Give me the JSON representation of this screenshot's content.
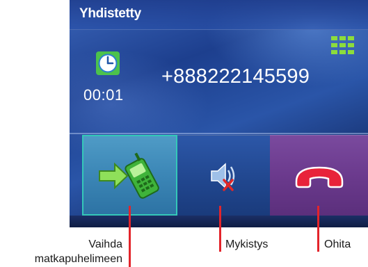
{
  "screen": {
    "title": "Yhdistetty",
    "call_timer": "00:01",
    "phone_number": "+888222145599",
    "icons": {
      "clock": "clock-icon",
      "keypad": "keypad-icon"
    },
    "buttons": [
      {
        "id": "transfer-to-mobile",
        "icon": "phone-transfer-icon"
      },
      {
        "id": "mute",
        "icon": "speaker-muted-icon"
      },
      {
        "id": "end-call",
        "icon": "hang-up-icon"
      }
    ],
    "colors": {
      "transfer_button": "#3b86b6",
      "mute_button": "#21478f",
      "end_button": "#6b3a8d",
      "leader_line": "#e3242b"
    }
  },
  "callouts": {
    "transfer_line1": "Vaihda",
    "transfer_line2": "matkapuhelimeen",
    "mute": "Mykistys",
    "end": "Ohita"
  }
}
